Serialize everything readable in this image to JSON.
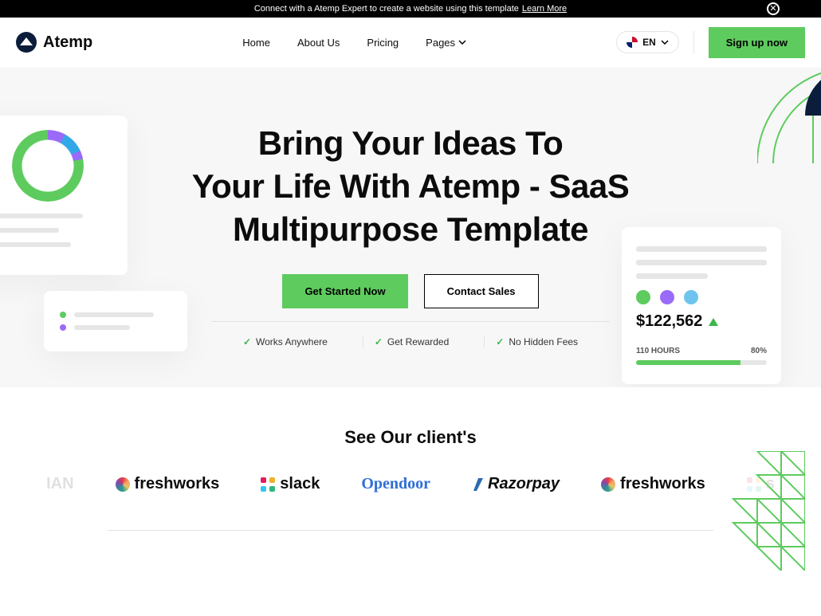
{
  "announce": {
    "text": "Connect with a Atemp Expert to create a website using this template",
    "link": "Learn More"
  },
  "brand": "Atemp",
  "nav": {
    "items": [
      "Home",
      "About Us",
      "Pricing",
      "Pages"
    ]
  },
  "lang": "EN",
  "signup": "Sign up now",
  "hero": {
    "title_l1": "Bring Your Ideas To",
    "title_l2": "Your Life With Atemp - SaaS",
    "title_l3": "Multipurpose Template",
    "cta_primary": "Get Started Now",
    "cta_secondary": "Contact Sales",
    "features": [
      "Works Anywhere",
      "Get Rewarded",
      "No Hidden Fees"
    ]
  },
  "stat_card": {
    "amount": "$122,562",
    "hours": "110 HOURS",
    "percent": "80%"
  },
  "clients": {
    "heading": "See Our client's",
    "logos": [
      "IAN",
      "freshworks",
      "slack",
      "Opendoor",
      "Razorpay",
      "freshworks",
      "s"
    ]
  },
  "colors": {
    "accent": "#5ecb5e",
    "purple": "#9a6af8",
    "blue": "#34a7e8",
    "navy": "#0b1d3a"
  }
}
